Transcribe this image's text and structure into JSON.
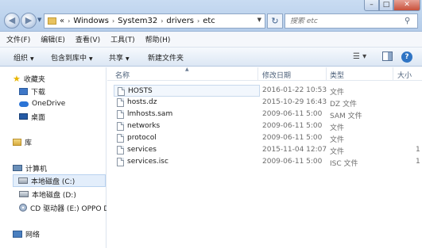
{
  "address": {
    "prefix": "«",
    "crumbs": [
      "Windows",
      "System32",
      "drivers",
      "etc"
    ]
  },
  "search": {
    "placeholder": "搜索 etc"
  },
  "menu": [
    "文件(F)",
    "编辑(E)",
    "查看(V)",
    "工具(T)",
    "帮助(H)"
  ],
  "toolbar": {
    "organize": "组织",
    "include": "包含到库中",
    "share": "共享",
    "new_folder": "新建文件夹"
  },
  "nav": {
    "favorites": "收藏夹",
    "downloads": "下载",
    "onedrive": "OneDrive",
    "desktop": "桌面",
    "libraries": "库",
    "computer": "计算机",
    "disk_c": "本地磁盘 (C:)",
    "disk_d": "本地磁盘 (D:)",
    "cd_drive": "CD 驱动器 (E:) OPPO D",
    "network": "网络"
  },
  "columns": {
    "name": "名称",
    "date": "修改日期",
    "type": "类型",
    "size": "大小"
  },
  "files": [
    {
      "name": "HOSTS",
      "date": "2016-01-22 10:53",
      "type": "文件",
      "size": ""
    },
    {
      "name": "hosts.dz",
      "date": "2015-10-29 16:43",
      "type": "DZ 文件",
      "size": ""
    },
    {
      "name": "lmhosts.sam",
      "date": "2009-06-11 5:00",
      "type": "SAM 文件",
      "size": ""
    },
    {
      "name": "networks",
      "date": "2009-06-11 5:00",
      "type": "文件",
      "size": ""
    },
    {
      "name": "protocol",
      "date": "2009-06-11 5:00",
      "type": "文件",
      "size": ""
    },
    {
      "name": "services",
      "date": "2015-11-04 12:07",
      "type": "文件",
      "size": "1"
    },
    {
      "name": "services.isc",
      "date": "2009-06-11 5:00",
      "type": "ISC 文件",
      "size": "1"
    }
  ]
}
